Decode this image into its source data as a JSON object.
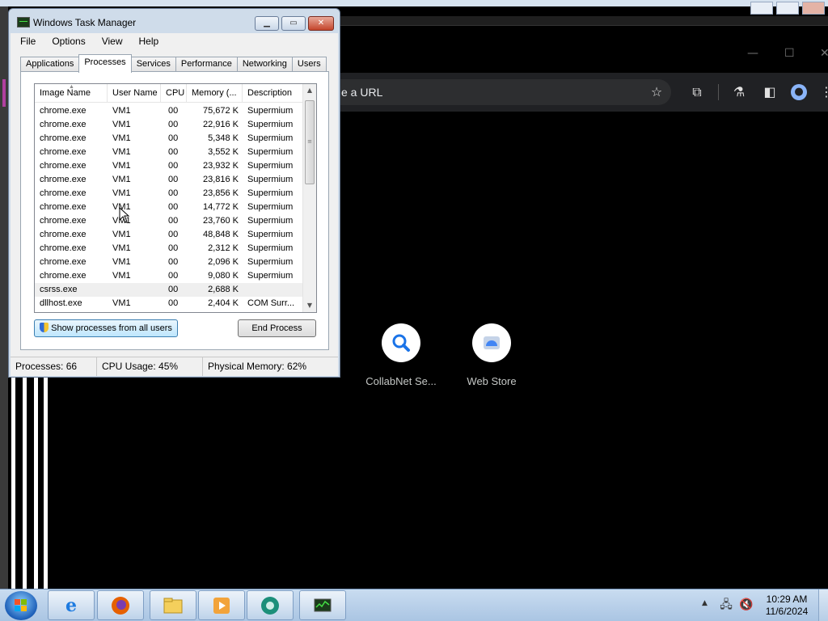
{
  "task_manager": {
    "title": "Windows Task Manager",
    "menu": [
      "File",
      "Options",
      "View",
      "Help"
    ],
    "tabs": [
      "Applications",
      "Processes",
      "Services",
      "Performance",
      "Networking",
      "Users"
    ],
    "active_tab": "Processes",
    "columns": [
      "Image Name",
      "User Name",
      "CPU",
      "Memory (...",
      "Description"
    ],
    "processes": [
      {
        "image": "chrome.exe",
        "user": "VM1",
        "cpu": "00",
        "memory": "75,672 K",
        "desc": "Supermium"
      },
      {
        "image": "chrome.exe",
        "user": "VM1",
        "cpu": "00",
        "memory": "22,916 K",
        "desc": "Supermium"
      },
      {
        "image": "chrome.exe",
        "user": "VM1",
        "cpu": "00",
        "memory": "5,348 K",
        "desc": "Supermium"
      },
      {
        "image": "chrome.exe",
        "user": "VM1",
        "cpu": "00",
        "memory": "3,552 K",
        "desc": "Supermium"
      },
      {
        "image": "chrome.exe",
        "user": "VM1",
        "cpu": "00",
        "memory": "23,932 K",
        "desc": "Supermium"
      },
      {
        "image": "chrome.exe",
        "user": "VM1",
        "cpu": "00",
        "memory": "23,816 K",
        "desc": "Supermium"
      },
      {
        "image": "chrome.exe",
        "user": "VM1",
        "cpu": "00",
        "memory": "23,856 K",
        "desc": "Supermium"
      },
      {
        "image": "chrome.exe",
        "user": "VM1",
        "cpu": "00",
        "memory": "14,772 K",
        "desc": "Supermium"
      },
      {
        "image": "chrome.exe",
        "user": "VM1",
        "cpu": "00",
        "memory": "23,760 K",
        "desc": "Supermium"
      },
      {
        "image": "chrome.exe",
        "user": "VM1",
        "cpu": "00",
        "memory": "48,848 K",
        "desc": "Supermium"
      },
      {
        "image": "chrome.exe",
        "user": "VM1",
        "cpu": "00",
        "memory": "2,312 K",
        "desc": "Supermium"
      },
      {
        "image": "chrome.exe",
        "user": "VM1",
        "cpu": "00",
        "memory": "2,096 K",
        "desc": "Supermium"
      },
      {
        "image": "chrome.exe",
        "user": "VM1",
        "cpu": "00",
        "memory": "9,080 K",
        "desc": "Supermium"
      },
      {
        "image": "csrss.exe",
        "user": "",
        "cpu": "00",
        "memory": "2,688 K",
        "desc": ""
      },
      {
        "image": "dllhost.exe",
        "user": "VM1",
        "cpu": "00",
        "memory": "2,404 K",
        "desc": "COM Surr..."
      }
    ],
    "show_all_label": "Show processes from all users",
    "end_process_label": "End Process",
    "status": {
      "processes": "Processes: 66",
      "cpu": "CPU Usage: 45%",
      "memory": "Physical Memory: 62%"
    }
  },
  "browser": {
    "omnibox_text": "e a URL",
    "shortcuts": [
      {
        "label": "CollabNet Se...",
        "icon": "search-icon"
      },
      {
        "label": "Web Store",
        "icon": "web-store-icon"
      }
    ]
  },
  "taskbar": {
    "apps": [
      "internet-explorer-icon",
      "firefox-icon",
      "file-explorer-icon",
      "media-player-icon",
      "supermium-icon",
      "task-manager-icon"
    ],
    "time": "10:29 AM",
    "date": "11/6/2024"
  },
  "colors": {
    "taskbar": "#aac5e3",
    "window_frame": "#cfdcea",
    "chrome_toolbar": "#202124",
    "close_button": "#c4452c"
  }
}
